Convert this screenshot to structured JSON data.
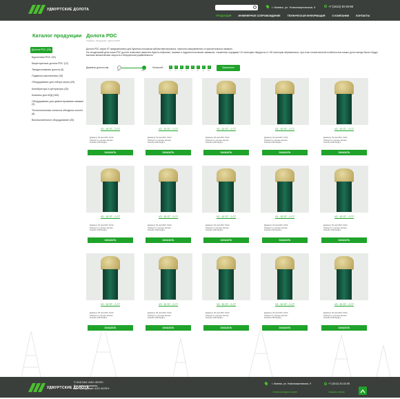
{
  "header": {
    "logo_text": "УДМУРТСКИЕ ДОЛОТА",
    "address": "г. Ижевск, ул. Новосмирновская, 9",
    "phone": "+7 (3412) 40-33-98",
    "nav": [
      "ПРОДУКЦИЯ",
      "ИНЖЕНЕРНОЕ СОПРОВОЖДЕНИЕ",
      "ТЕХНИЧЕСКАЯ ИНФОРМАЦИЯ",
      "О КОМПАНИИ",
      "КОНТАКТЫ"
    ]
  },
  "sidebar": {
    "title": "Каталог продукции",
    "items": [
      "Долота PDC (25)",
      "Бурголовки PDC (30)",
      "Бицентричные долота PDC (12)",
      "Твердосплавные долота (5)",
      "Подвески-наконечники (15)",
      "Оборудование для отбора керна (25)",
      "Калибраторы и центраторы (25)",
      "Клапаны для КОД (184)",
      "Оборудование для цементирования скважин (3)",
      "Технологическая оснастка обсадных колонн (8)",
      "Вспомогательное оборудование (35)"
    ]
  },
  "main": {
    "title": "Долота PDC",
    "breadcrumb": "Главная › Продукция › Долота PDC",
    "intro1": "Долота PDC серии ST предназначены для бурения сплошным забоем вертикальных, наклонно-направленных и горизонтальных скважин.",
    "intro2": "На сегодняшний день наши PDC долота позволяют уверенно бурить нефтяные, газовые и гидрогеологические скважины, сложенные породами I-IV категории твёрдости и I-VIII категории абразивности, при этом отличительной особенностью наших долот всегда были и будут высокая механическая скорость и безупречная управляемость."
  },
  "filters": {
    "diameter_label": "Диаметр долота мм",
    "diameter_min": "90",
    "diameter_max": "555",
    "blades_label": "Лопастей",
    "blade_values": [
      "3",
      "4",
      "5",
      "6",
      "7",
      "8",
      "9",
      "10"
    ],
    "apply_label": "Применить"
  },
  "product": {
    "name": "V3 - 92 ST - 2 CT",
    "desc1": "Диаметр 92 мм     IADC S132",
    "desc2": "Твёрдость породы мягкая",
    "desc3": "Резьба 3-88 Муфта",
    "button": "ЗАКАЗАТЬ"
  },
  "footer": {
    "copy1": "© 2018 ОАО «ЗАО «БУОП»",
    "copy2": "Все права защищены,",
    "copy3": "сайт принадлежит ООО «БУОП»",
    "address": "г. Ижевск, ул. Новосмирновская, 9",
    "phone": "+7 (3412) 40-33-98",
    "link1": "Схема проезда на карте",
    "link2": "Заказать звонок"
  },
  "colors": {
    "accent": "#1fa32a",
    "dark": "#3a3f3b"
  }
}
